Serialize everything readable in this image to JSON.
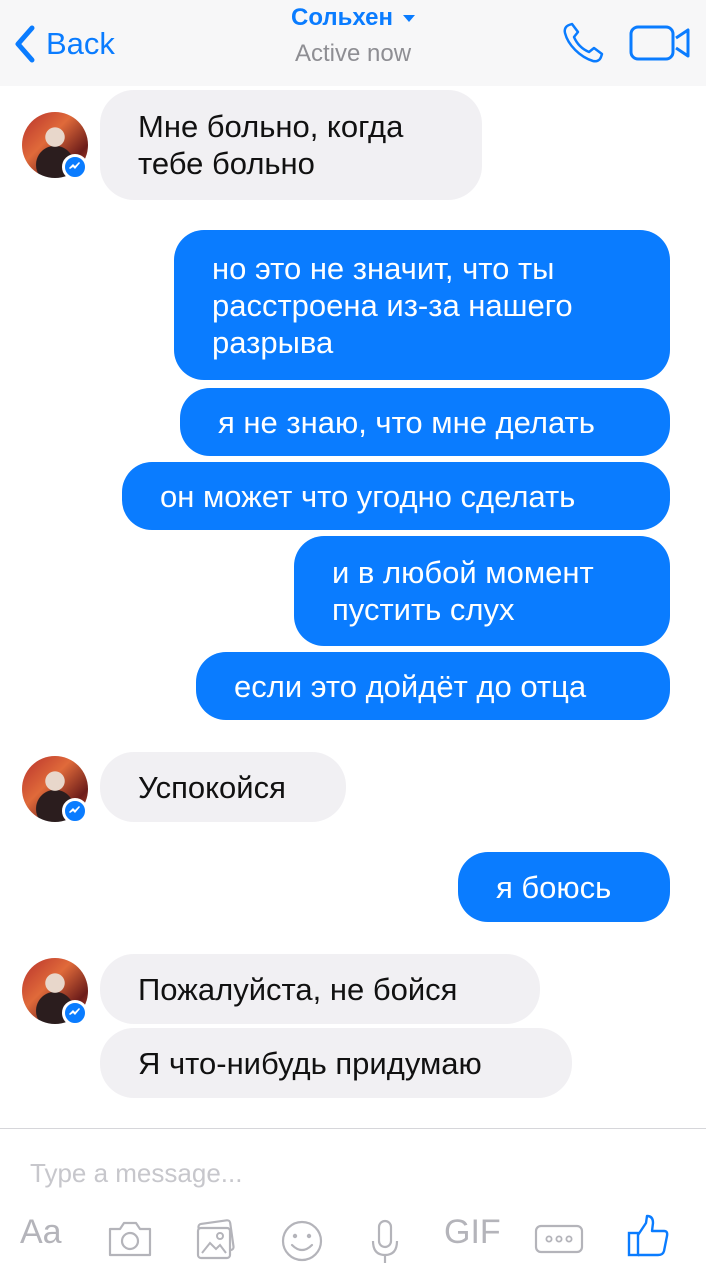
{
  "header": {
    "back_label": "Back",
    "contact_name": "Сольхен",
    "status": "Active now"
  },
  "colors": {
    "accent": "#0a7cff",
    "incoming_bubble": "#f1f0f3",
    "outgoing_bubble": "#0a7cff"
  },
  "messages": [
    {
      "direction": "incoming",
      "text": "Мне больно, когда тебе больно"
    },
    {
      "direction": "outgoing",
      "text": "но это не значит, что ты расстроена из-за нашего разрыва"
    },
    {
      "direction": "outgoing",
      "text": "я не знаю, что мне делать"
    },
    {
      "direction": "outgoing",
      "text": "он может что угодно сделать"
    },
    {
      "direction": "outgoing",
      "text": "и в любой момент пустить слух"
    },
    {
      "direction": "outgoing",
      "text": "если это дойдёт до отца"
    },
    {
      "direction": "incoming",
      "text": "Успокойся"
    },
    {
      "direction": "outgoing",
      "text": "я боюсь"
    },
    {
      "direction": "incoming",
      "text": "Пожалуйста, не бойся"
    },
    {
      "direction": "incoming",
      "text": "Я что-нибудь придумаю"
    }
  ],
  "composer": {
    "placeholder": "Type a message...",
    "text_button": "Aa",
    "gif_button": "GIF"
  },
  "icons": [
    "back-chevron-icon",
    "call-icon",
    "video-call-icon",
    "messenger-icon",
    "camera-icon",
    "gallery-icon",
    "emoji-icon",
    "microphone-icon",
    "more-icon",
    "like-icon"
  ]
}
